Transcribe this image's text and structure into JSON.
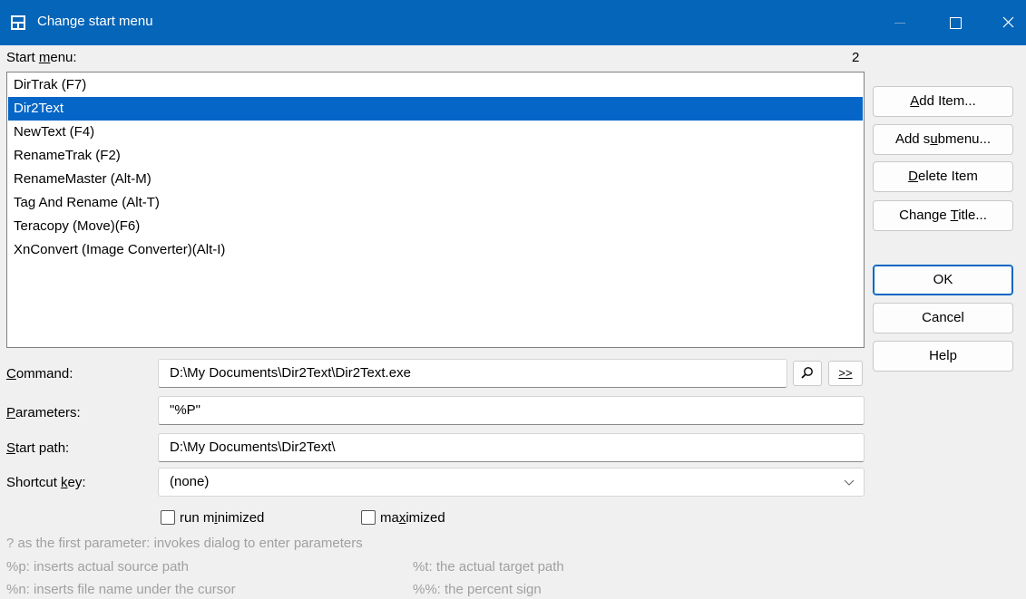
{
  "window": {
    "title": "Change start menu"
  },
  "start_menu": {
    "label_prefix": "Start ",
    "label_mnemonic": "m",
    "label_suffix": "enu:",
    "count": "2",
    "items": [
      {
        "label": "DirTrak (F7)",
        "selected": false
      },
      {
        "label": "Dir2Text",
        "selected": true
      },
      {
        "label": "NewText (F4)",
        "selected": false
      },
      {
        "label": "RenameTrak (F2)",
        "selected": false
      },
      {
        "label": "RenameMaster (Alt-M)",
        "selected": false
      },
      {
        "label": "Tag And Rename (Alt-T)",
        "selected": false
      },
      {
        "label": "Teracopy (Move)(F6)",
        "selected": false
      },
      {
        "label": "XnConvert (Image Converter)(Alt-I)",
        "selected": false
      }
    ]
  },
  "buttons": {
    "add_item": {
      "m": "A",
      "rest": "dd Item..."
    },
    "add_submenu": {
      "pre": "Add s",
      "m": "u",
      "rest": "bmenu..."
    },
    "delete_item": {
      "m": "D",
      "rest": "elete Item"
    },
    "change_title": {
      "pre": "Change ",
      "m": "T",
      "rest": "itle..."
    },
    "ok": "OK",
    "cancel": "Cancel",
    "help": "Help"
  },
  "form": {
    "command": {
      "m": "C",
      "rest": "ommand:",
      "value": "D:\\My Documents\\Dir2Text\\Dir2Text.exe"
    },
    "parameters": {
      "m": "P",
      "rest": "arameters:",
      "value": "\"%P\""
    },
    "start_path": {
      "m": "S",
      "rest": "tart path:",
      "value": "D:\\My Documents\\Dir2Text\\"
    },
    "shortcut_key": {
      "pre": "Shortcut ",
      "m": "k",
      "rest": "ey:",
      "value": "(none)"
    },
    "browse_icon": "magnifier-icon",
    "more_button": ">>",
    "run_minimized": {
      "pre": "run m",
      "m": "i",
      "rest": "nimized",
      "checked": false
    },
    "maximized": {
      "pre": "ma",
      "m": "x",
      "rest": "imized",
      "checked": false
    }
  },
  "hints": {
    "line1": "? as the first parameter: invokes dialog to enter parameters",
    "p": "%p: inserts actual source path",
    "t": "%t: the actual target path",
    "n": "%n: inserts file name under the cursor",
    "pct": "%%: the percent sign"
  },
  "colors": {
    "titlebar": "#0565b8",
    "selection": "#0566c7"
  }
}
